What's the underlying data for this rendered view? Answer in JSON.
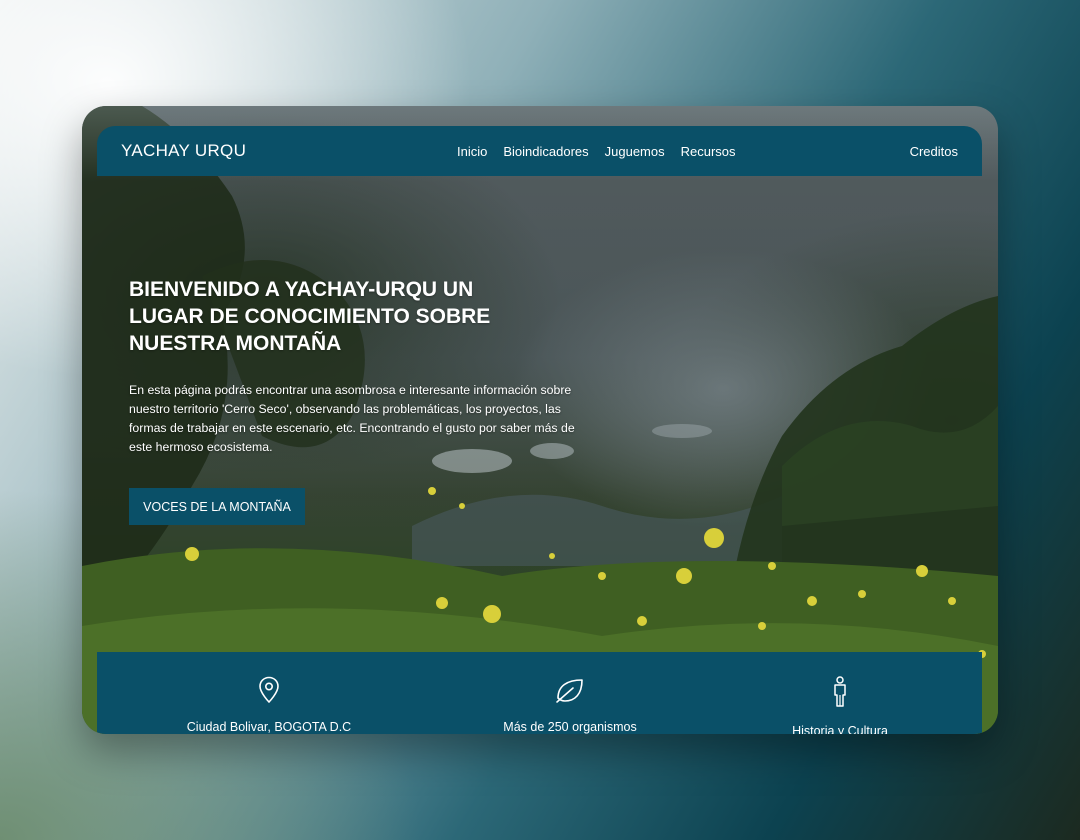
{
  "navbar": {
    "brand": "YACHAY URQU",
    "links": [
      "Inicio",
      "Bioindicadores",
      "Juguemos",
      "Recursos"
    ],
    "credits": "Creditos"
  },
  "hero": {
    "title": "BIENVENIDO A YACHAY-URQU UN LUGAR DE CONOCIMIENTO SOBRE NUESTRA MONTAÑA",
    "description": "En esta página podrás encontrar una asombrosa e interesante información sobre nuestro territorio 'Cerro Seco', observando las problemáticas, los proyectos, las formas de trabajar en este escenario, etc. Encontrando el gusto por saber más de este hermoso ecosistema.",
    "button": "VOCES DE LA MONTAÑA"
  },
  "features": [
    {
      "icon": "location-pin-icon",
      "label": "Ciudad Bolivar, BOGOTA D.C"
    },
    {
      "icon": "leaf-icon",
      "label": "Más de 250 organismos"
    },
    {
      "icon": "person-icon",
      "label": "Historia y Cultura"
    }
  ],
  "colors": {
    "primary": "#0a5068",
    "text_light": "#ffffff"
  }
}
